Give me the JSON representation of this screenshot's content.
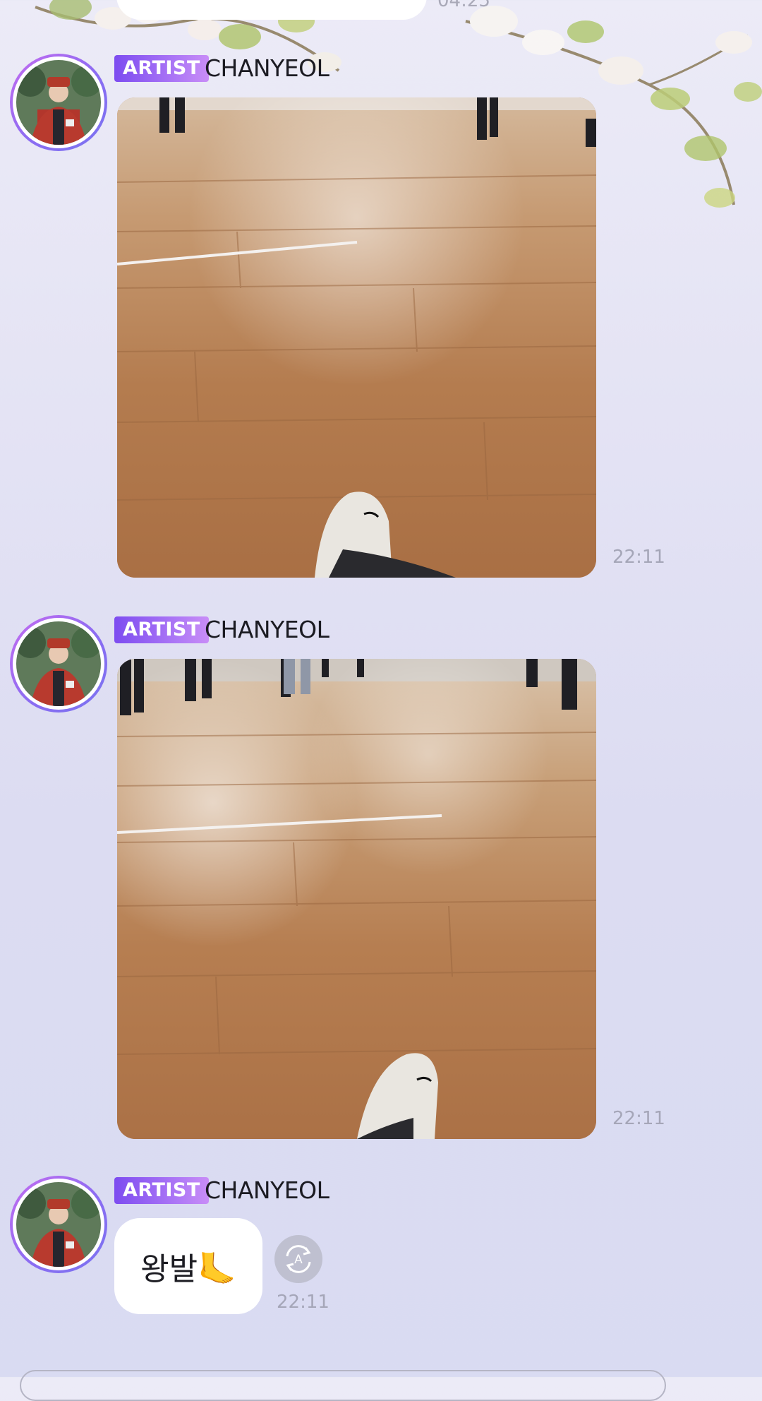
{
  "colors": {
    "badge_start": "#7d4cf0",
    "badge_end": "#c98df7",
    "timestamp": "#a5a6b8",
    "bubble": "#ffffff",
    "background": "#dcdcf2"
  },
  "previous_message": {
    "time": "04:25"
  },
  "messages": [
    {
      "badge": "ARTIST",
      "sender": "CHANYEOL",
      "kind": "photo",
      "image_description": "photo of a wooden dance-studio floor with a white sneaker at the bottom",
      "time": "22:11"
    },
    {
      "badge": "ARTIST",
      "sender": "CHANYEOL",
      "kind": "photo",
      "image_description": "photo of a wooden dance-studio floor with a white sneaker at the bottom",
      "time": "22:11"
    },
    {
      "badge": "ARTIST",
      "sender": "CHANYEOL",
      "kind": "text",
      "text": "왕발🦶",
      "translate_icon": "translate-icon",
      "time": "22:11"
    }
  ],
  "icons": {
    "avatar": "avatar-icon",
    "translate": "translate-icon",
    "blossom": "cherry-blossom-decoration"
  }
}
